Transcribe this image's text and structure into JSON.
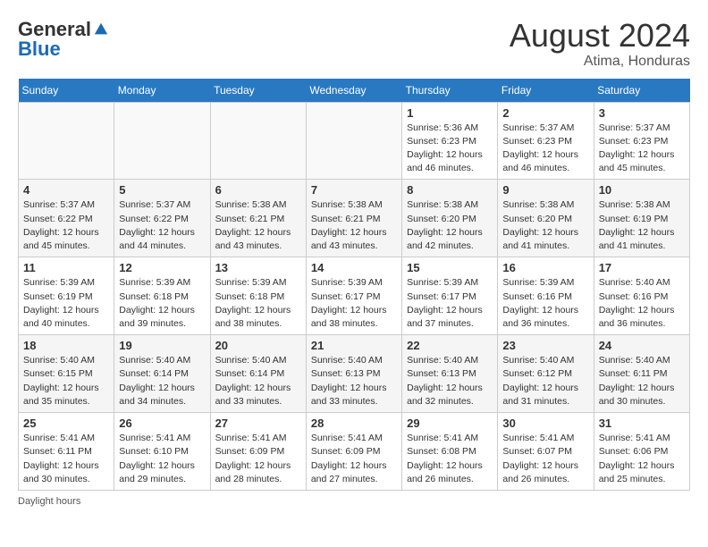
{
  "header": {
    "logo_general": "General",
    "logo_blue": "Blue",
    "month": "August 2024",
    "location": "Atima, Honduras"
  },
  "days_of_week": [
    "Sunday",
    "Monday",
    "Tuesday",
    "Wednesday",
    "Thursday",
    "Friday",
    "Saturday"
  ],
  "weeks": [
    [
      {
        "day": "",
        "info": ""
      },
      {
        "day": "",
        "info": ""
      },
      {
        "day": "",
        "info": ""
      },
      {
        "day": "",
        "info": ""
      },
      {
        "day": "1",
        "info": "Sunrise: 5:36 AM\nSunset: 6:23 PM\nDaylight: 12 hours and 46 minutes."
      },
      {
        "day": "2",
        "info": "Sunrise: 5:37 AM\nSunset: 6:23 PM\nDaylight: 12 hours and 46 minutes."
      },
      {
        "day": "3",
        "info": "Sunrise: 5:37 AM\nSunset: 6:23 PM\nDaylight: 12 hours and 45 minutes."
      }
    ],
    [
      {
        "day": "4",
        "info": "Sunrise: 5:37 AM\nSunset: 6:22 PM\nDaylight: 12 hours and 45 minutes."
      },
      {
        "day": "5",
        "info": "Sunrise: 5:37 AM\nSunset: 6:22 PM\nDaylight: 12 hours and 44 minutes."
      },
      {
        "day": "6",
        "info": "Sunrise: 5:38 AM\nSunset: 6:21 PM\nDaylight: 12 hours and 43 minutes."
      },
      {
        "day": "7",
        "info": "Sunrise: 5:38 AM\nSunset: 6:21 PM\nDaylight: 12 hours and 43 minutes."
      },
      {
        "day": "8",
        "info": "Sunrise: 5:38 AM\nSunset: 6:20 PM\nDaylight: 12 hours and 42 minutes."
      },
      {
        "day": "9",
        "info": "Sunrise: 5:38 AM\nSunset: 6:20 PM\nDaylight: 12 hours and 41 minutes."
      },
      {
        "day": "10",
        "info": "Sunrise: 5:38 AM\nSunset: 6:19 PM\nDaylight: 12 hours and 41 minutes."
      }
    ],
    [
      {
        "day": "11",
        "info": "Sunrise: 5:39 AM\nSunset: 6:19 PM\nDaylight: 12 hours and 40 minutes."
      },
      {
        "day": "12",
        "info": "Sunrise: 5:39 AM\nSunset: 6:18 PM\nDaylight: 12 hours and 39 minutes."
      },
      {
        "day": "13",
        "info": "Sunrise: 5:39 AM\nSunset: 6:18 PM\nDaylight: 12 hours and 38 minutes."
      },
      {
        "day": "14",
        "info": "Sunrise: 5:39 AM\nSunset: 6:17 PM\nDaylight: 12 hours and 38 minutes."
      },
      {
        "day": "15",
        "info": "Sunrise: 5:39 AM\nSunset: 6:17 PM\nDaylight: 12 hours and 37 minutes."
      },
      {
        "day": "16",
        "info": "Sunrise: 5:39 AM\nSunset: 6:16 PM\nDaylight: 12 hours and 36 minutes."
      },
      {
        "day": "17",
        "info": "Sunrise: 5:40 AM\nSunset: 6:16 PM\nDaylight: 12 hours and 36 minutes."
      }
    ],
    [
      {
        "day": "18",
        "info": "Sunrise: 5:40 AM\nSunset: 6:15 PM\nDaylight: 12 hours and 35 minutes."
      },
      {
        "day": "19",
        "info": "Sunrise: 5:40 AM\nSunset: 6:14 PM\nDaylight: 12 hours and 34 minutes."
      },
      {
        "day": "20",
        "info": "Sunrise: 5:40 AM\nSunset: 6:14 PM\nDaylight: 12 hours and 33 minutes."
      },
      {
        "day": "21",
        "info": "Sunrise: 5:40 AM\nSunset: 6:13 PM\nDaylight: 12 hours and 33 minutes."
      },
      {
        "day": "22",
        "info": "Sunrise: 5:40 AM\nSunset: 6:13 PM\nDaylight: 12 hours and 32 minutes."
      },
      {
        "day": "23",
        "info": "Sunrise: 5:40 AM\nSunset: 6:12 PM\nDaylight: 12 hours and 31 minutes."
      },
      {
        "day": "24",
        "info": "Sunrise: 5:40 AM\nSunset: 6:11 PM\nDaylight: 12 hours and 30 minutes."
      }
    ],
    [
      {
        "day": "25",
        "info": "Sunrise: 5:41 AM\nSunset: 6:11 PM\nDaylight: 12 hours and 30 minutes."
      },
      {
        "day": "26",
        "info": "Sunrise: 5:41 AM\nSunset: 6:10 PM\nDaylight: 12 hours and 29 minutes."
      },
      {
        "day": "27",
        "info": "Sunrise: 5:41 AM\nSunset: 6:09 PM\nDaylight: 12 hours and 28 minutes."
      },
      {
        "day": "28",
        "info": "Sunrise: 5:41 AM\nSunset: 6:09 PM\nDaylight: 12 hours and 27 minutes."
      },
      {
        "day": "29",
        "info": "Sunrise: 5:41 AM\nSunset: 6:08 PM\nDaylight: 12 hours and 26 minutes."
      },
      {
        "day": "30",
        "info": "Sunrise: 5:41 AM\nSunset: 6:07 PM\nDaylight: 12 hours and 26 minutes."
      },
      {
        "day": "31",
        "info": "Sunrise: 5:41 AM\nSunset: 6:06 PM\nDaylight: 12 hours and 25 minutes."
      }
    ]
  ],
  "footer": {
    "daylight_label": "Daylight hours"
  }
}
